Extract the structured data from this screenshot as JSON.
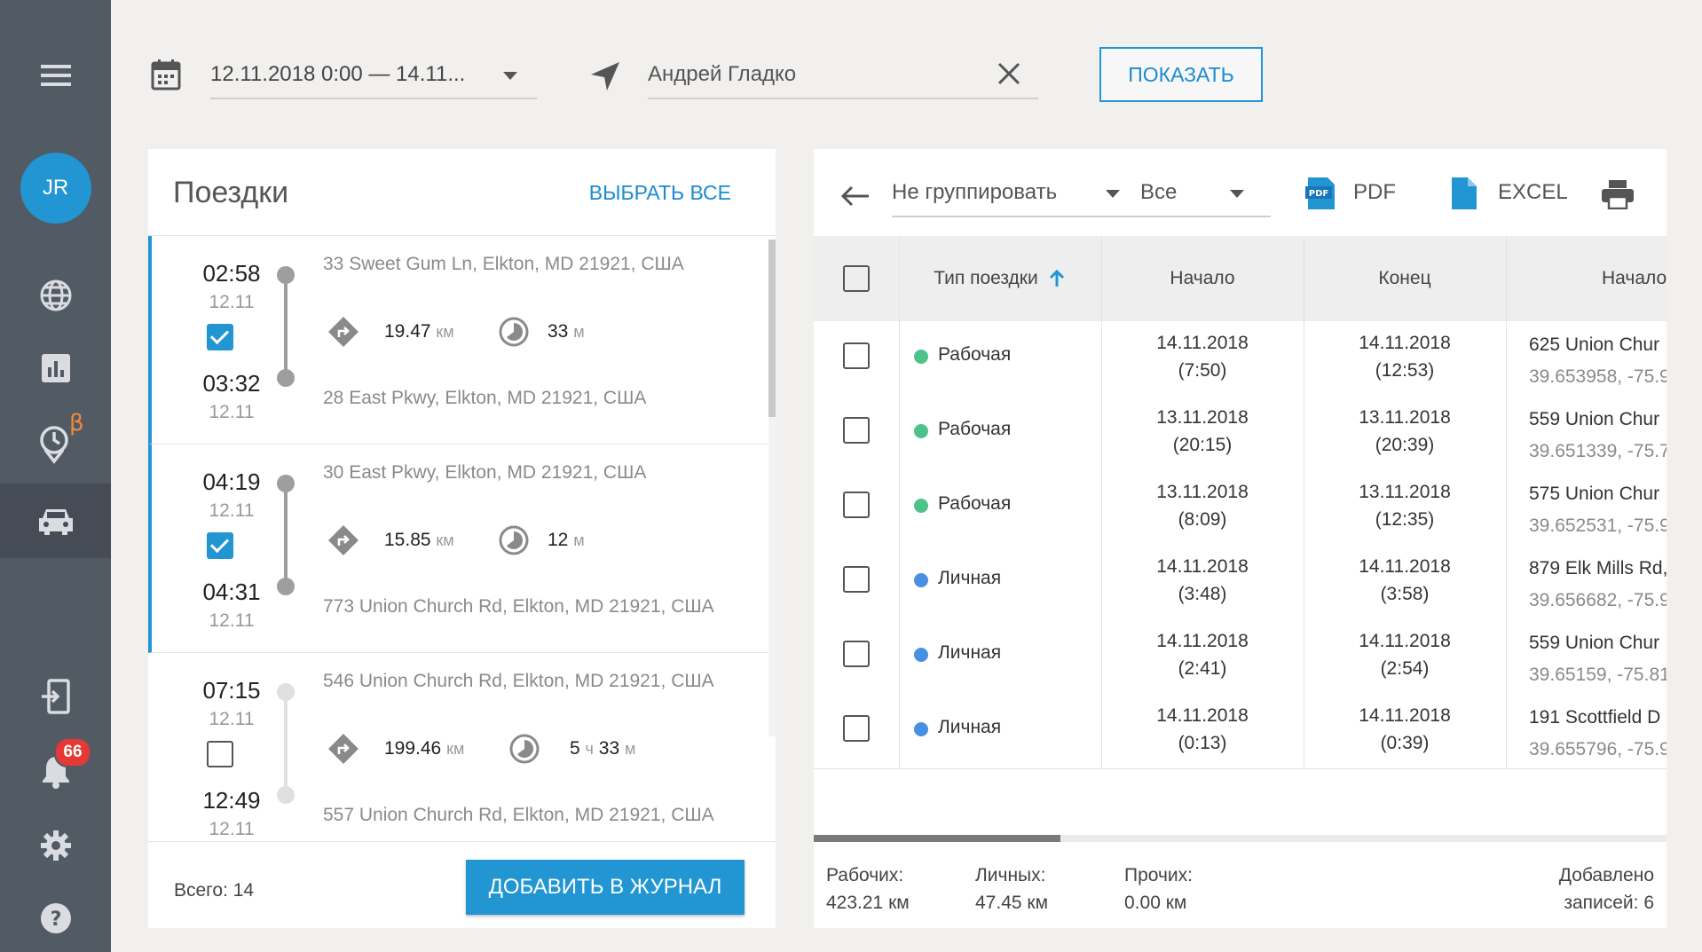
{
  "sidebar": {
    "avatar_initials": "JR",
    "beta_mark": "β",
    "notification_count": "66"
  },
  "filters": {
    "date_range": "12.11.2018 0:00 — 14.11...",
    "driver": "Андрей Гладко",
    "show_button": "ПОКАЗАТЬ"
  },
  "trips_panel": {
    "title": "Поездки",
    "select_all": "ВЫБРАТЬ ВСЕ",
    "total": "Всего: 14",
    "add_button": "ДОБАВИТЬ В ЖУРНАЛ",
    "trips": [
      {
        "start_time": "02:58",
        "start_date": "12.11",
        "end_time": "03:32",
        "end_date": "12.11",
        "checked": true,
        "from": "33 Sweet Gum Ln, Elkton, MD 21921, США",
        "to": "28 East Pkwy, Elkton, MD 21921, США",
        "distance": "19.47",
        "distance_unit": "км",
        "duration": "33",
        "duration_unit": "м"
      },
      {
        "start_time": "04:19",
        "start_date": "12.11",
        "end_time": "04:31",
        "end_date": "12.11",
        "checked": true,
        "from": "30 East Pkwy, Elkton, MD 21921, США",
        "to": "773 Union Church Rd, Elkton, MD 21921, США",
        "distance": "15.85",
        "distance_unit": "км",
        "duration": "12",
        "duration_unit": "м"
      },
      {
        "start_time": "07:15",
        "start_date": "12.11",
        "end_time": "12:49",
        "end_date": "12.11",
        "checked": false,
        "from": "546 Union Church Rd, Elkton, MD 21921, США",
        "to": "557 Union Church Rd, Elkton, MD 21921, США",
        "distance": "199.46",
        "distance_unit": "км",
        "duration_h": "5",
        "duration_h_unit": "ч",
        "duration": "33",
        "duration_unit": "м"
      }
    ]
  },
  "table_panel": {
    "group_select": "Не группировать",
    "filter_select": "Все",
    "pdf_label": "PDF",
    "excel_label": "EXCEL",
    "columns": [
      "Тип поездки",
      "Начало",
      "Конец",
      "Начало"
    ],
    "rows": [
      {
        "type": "Рабочая",
        "type_color": "#4cc38a",
        "start": "14.11.2018",
        "start_time": "(7:50)",
        "end": "14.11.2018",
        "end_time": "(12:53)",
        "addr": "625 Union Chur",
        "coord": "39.653958, -75.9"
      },
      {
        "type": "Рабочая",
        "type_color": "#4cc38a",
        "start": "13.11.2018",
        "start_time": "(20:15)",
        "end": "13.11.2018",
        "end_time": "(20:39)",
        "addr": "559 Union Chur",
        "coord": "39.651339, -75.7"
      },
      {
        "type": "Рабочая",
        "type_color": "#4cc38a",
        "start": "13.11.2018",
        "start_time": "(8:09)",
        "end": "13.11.2018",
        "end_time": "(12:35)",
        "addr": "575 Union Chur",
        "coord": "39.652531, -75.9"
      },
      {
        "type": "Личная",
        "type_color": "#4a90e2",
        "start": "14.11.2018",
        "start_time": "(3:48)",
        "end": "14.11.2018",
        "end_time": "(3:58)",
        "addr": "879 Elk Mills Rd,",
        "coord": "39.656682, -75.9"
      },
      {
        "type": "Личная",
        "type_color": "#4a90e2",
        "start": "14.11.2018",
        "start_time": "(2:41)",
        "end": "14.11.2018",
        "end_time": "(2:54)",
        "addr": "559 Union Chur",
        "coord": "39.65159, -75.81"
      },
      {
        "type": "Личная",
        "type_color": "#4a90e2",
        "start": "14.11.2018",
        "start_time": "(0:13)",
        "end": "14.11.2018",
        "end_time": "(0:39)",
        "addr": "191 Scottfield D",
        "coord": "39.655796, -75.9"
      }
    ],
    "summary": {
      "work_label": "Рабочих:",
      "work_value": "423.21 км",
      "personal_label": "Личных:",
      "personal_value": "47.45 км",
      "other_label": "Прочих:",
      "other_value": "0.00 км",
      "added_label": "Добавлено",
      "added_value": "записей: 6"
    }
  },
  "colors": {
    "accent": "#2196d3",
    "sidebar": "#525a64",
    "badge": "#e53935",
    "beta": "#f2893a"
  }
}
